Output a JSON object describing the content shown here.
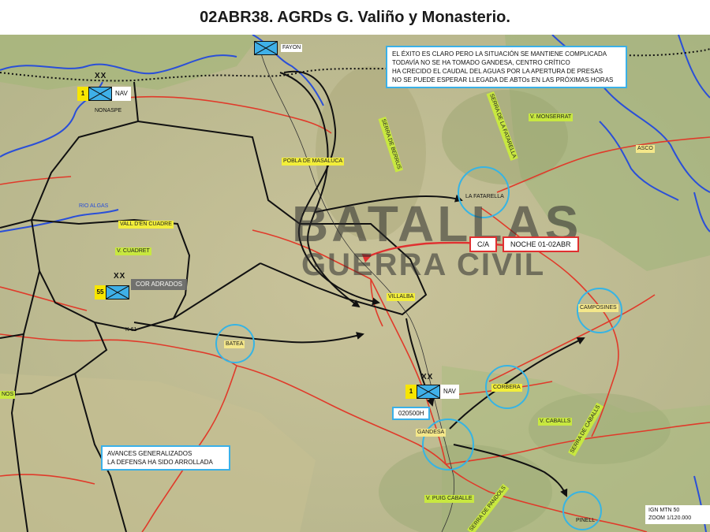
{
  "title": "02ABR38. AGRDs G. Valiño y Monasterio.",
  "note_top": [
    "EL ÉXITO ES CLARO PERO LA SITUACIÓN SE MANTIENE COMPLICADA",
    "TODAVÍA NO SE HA TOMADO GANDESA, CENTRO CRÍTICO",
    "HA CRECIDO EL CAUDAL DEL AGUAS POR LA APERTURA DE PRESAS",
    "NO SE PUEDE ESPERAR LLEGADA DE ABTOs EN LAS PRÓXIMAS HORAS"
  ],
  "note_bottom": [
    "AVANCES GENERALIZADOS",
    "LA DEFENSA HA SIDO ARROLLADA"
  ],
  "counterattack": {
    "ca": "C/A",
    "time": "NOCHE 01-02ABR"
  },
  "units": {
    "nav_north": {
      "num": "1",
      "tag": "NAV",
      "echelon": "XX"
    },
    "cor": {
      "num": "55",
      "tag": "COR ADRADOS",
      "echelon": "XX"
    },
    "nav_south": {
      "num": "1",
      "tag": "NAV",
      "echelon": "XX",
      "time": "020500H"
    },
    "top": {
      "num": "",
      "tag": "FAYON",
      "echelon": ""
    }
  },
  "places": {
    "nonaspe": "NONASPE",
    "pobla": "POBLA DE MASALUCA",
    "rio_algas": "RIO ALGAS",
    "vall": "VALL D'EN CUADRE",
    "v_cuadret": "V. CUADRET",
    "fatarella": "LA FATARELLA",
    "v_monserrat": "V. MONSERRAT",
    "asco": "ASCO",
    "villalba": "VILLALBA",
    "batea": "BATEA",
    "k61": "K 61",
    "camposines": "CAMPOSINES",
    "corbera": "CORBERA",
    "gandesa": "GANDESA",
    "v_caballs": "V. CABALLS",
    "serra_caballs": "SERRA DE CABALLS",
    "v_puig": "V. PUIG CABALLE",
    "pinell": "PINELL",
    "serra_fatarella": "SERRA DE LA FATARELLA",
    "serra_gerbus": "SERRA DE BERRUS",
    "serra_pandols": "SERRA DE PANDOLS",
    "nos": "NOS"
  },
  "scale": {
    "line1": "IGN MTN 50",
    "line2": "ZOOM 1/120.000"
  },
  "watermark": {
    "line1": "BATALLAS",
    "line2": "GUERRA CIVIL"
  },
  "colors": {
    "road": "#e03a2a",
    "river": "#2a4fd8",
    "front": "#111111",
    "circle": "#36b4e4",
    "highlight": "#f2ee3a",
    "green_label": "#c8e840"
  }
}
